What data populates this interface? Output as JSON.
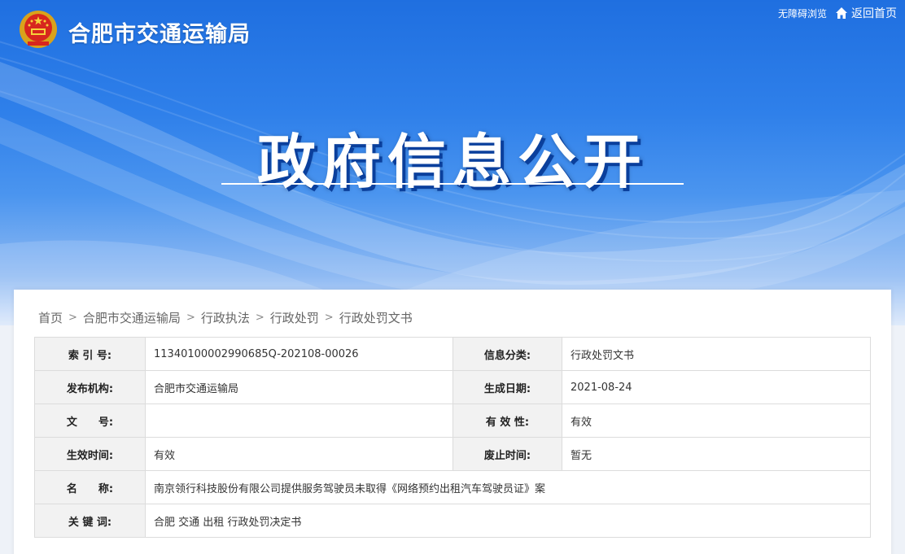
{
  "header": {
    "site_title": "合肥市交通运输局",
    "accessible_link": "无障碍浏览",
    "home_link": "返回首页",
    "emblem_icon": "national-emblem-icon",
    "home_icon": "home-icon"
  },
  "hero": {
    "title": "政府信息公开"
  },
  "breadcrumb": {
    "items": [
      "首页",
      "合肥市交通运输局",
      "行政执法",
      "行政处罚",
      "行政处罚文书"
    ],
    "separator": ">"
  },
  "info_table": {
    "rows": [
      {
        "label1": "索 引 号:",
        "value1": "11340100002990685Q-202108-00026",
        "label2": "信息分类:",
        "value2": "行政处罚文书"
      },
      {
        "label1": "发布机构:",
        "value1": "合肥市交通运输局",
        "label2": "生成日期:",
        "value2": "2021-08-24"
      },
      {
        "label1": "文　　号:",
        "value1": "",
        "label2": "有 效 性:",
        "value2": "有效"
      },
      {
        "label1": "生效时间:",
        "value1": "有效",
        "label2": "废止时间:",
        "value2": "暂无"
      }
    ],
    "name_label": "名　　称:",
    "name_value": "南京领行科技股份有限公司提供服务驾驶员未取得《网络预约出租汽车驾驶员证》案",
    "keywords_label": "关 键 词:",
    "keywords_value": "合肥 交通 出租 行政处罚决定书"
  },
  "colors": {
    "banner_top": "#1f6fe0",
    "banner_bottom": "#dbe8fb",
    "label_bg": "#f2f2f2",
    "hero_shadow": "#0a3f9c"
  }
}
